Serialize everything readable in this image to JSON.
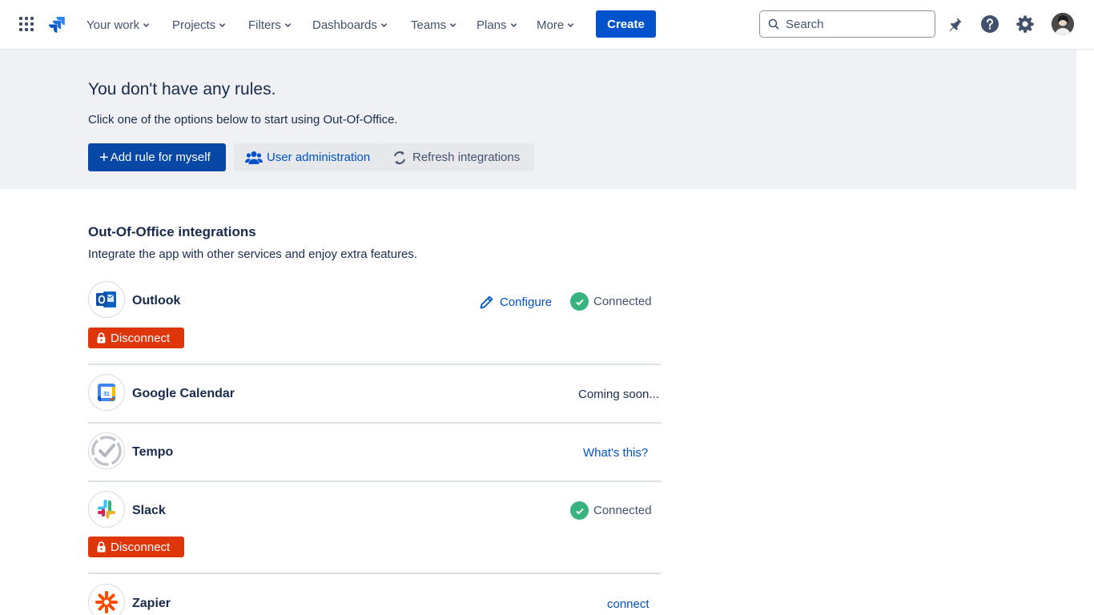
{
  "nav": {
    "items": [
      "Your work",
      "Projects",
      "Filters",
      "Dashboards",
      "Teams",
      "Plans",
      "More"
    ],
    "create_label": "Create",
    "search_placeholder": "Search"
  },
  "banner": {
    "title": "You don't have any rules.",
    "subtitle": "Click one of the options below to start using Out-Of-Office.",
    "add_rule_label": "Add rule for myself",
    "user_admin_label": "User administration",
    "refresh_label": "Refresh integrations"
  },
  "integrations": {
    "title": "Out-Of-Office integrations",
    "subtitle": "Integrate the app with other services and enjoy extra features.",
    "disconnect_label": "Disconnect",
    "items": [
      {
        "name": "Outlook",
        "action": "Configure",
        "status": "Connected"
      },
      {
        "name": "Google Calendar",
        "status": "Coming soon..."
      },
      {
        "name": "Tempo",
        "action": "What's this?"
      },
      {
        "name": "Slack",
        "status": "Connected"
      },
      {
        "name": "Zapier",
        "action": "connect"
      }
    ]
  },
  "colors": {
    "primary": "#0052cc",
    "banner_bg": "#f0f1f4",
    "danger": "#de350b",
    "success": "#36b37e"
  }
}
